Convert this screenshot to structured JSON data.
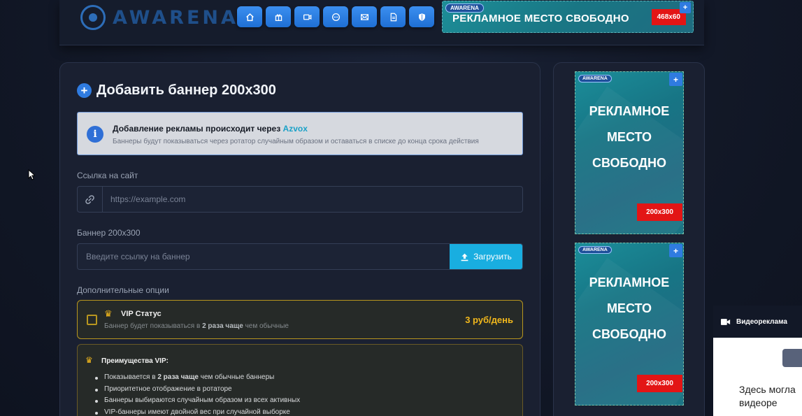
{
  "header": {
    "logo_text": "AWARENA",
    "nav_icons": [
      "home-icon",
      "gift-icon",
      "video-icon",
      "chat-icon",
      "mail-icon",
      "document-icon",
      "shield-icon"
    ],
    "top_banner": {
      "badge": "AWARENA",
      "text": "РЕКЛАМНОЕ  МЕСТО СВОБОДНО",
      "size": "468x60",
      "plus": "+"
    }
  },
  "form": {
    "plus": "+",
    "title": "Добавить баннер 200x300",
    "info": {
      "title_prefix": "Добавление рекламы происходит через",
      "title_link": "Azvox",
      "subtitle": "Баннеры будут показываться через ротатор случайным образом и оставаться в списке до конца срока действия"
    },
    "site_link_label": "Ссылка на сайт",
    "site_link_placeholder": "https://example.com",
    "banner_label": "Баннер 200x300",
    "banner_placeholder": "Введите ссылку на баннер",
    "upload_label": "Загрузить",
    "options_label": "Дополнительные опции",
    "vip": {
      "title": "VIP Статус",
      "sub_prefix": "Баннер будет показываться в",
      "sub_bold": "2 раза чаще",
      "sub_suffix": "чем обычные",
      "price": "3 руб/день"
    },
    "benefits": {
      "title": "Преимущества VIP:",
      "item1_prefix": "Показывается в",
      "item1_bold": "2 раза чаще",
      "item1_suffix": "чем обычные баннеры",
      "item2": "Приоритетное отображение в ротаторе",
      "item3": "Баннеры выбираются случайным образом из всех активных",
      "item4": "VIP-баннеры имеют двойной вес при случайной выборке"
    }
  },
  "sidebar": {
    "banners": [
      {
        "badge": "AWARENA",
        "text": "РЕКЛАМНОЕ\nМЕСТО\nСВОБОДНО",
        "size": "200x300",
        "plus": "+"
      },
      {
        "badge": "AWARENA",
        "text": "РЕКЛАМНОЕ\nМЕСТО\nСВОБОДНО",
        "size": "200x300",
        "plus": "+"
      }
    ]
  },
  "video_widget": {
    "title": "Видеореклама",
    "text": "Здесь могла\nвидеоре"
  },
  "colors": {
    "accent": "#2f7be0",
    "upload": "#19aee0",
    "vip_gold": "#f2b81c",
    "size_badge": "#e31515"
  }
}
